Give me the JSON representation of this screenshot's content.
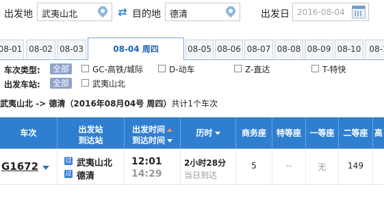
{
  "search": {
    "from_label": "出发地",
    "from_value": "武夷山北",
    "to_label": "目的地",
    "to_value": "德清",
    "date_label": "出发日",
    "date_value": "2016-08-04"
  },
  "date_tabs": [
    "08-01",
    "08-02",
    "08-03",
    "08-04 周四",
    "08-05",
    "08-06",
    "08-07",
    "08-08",
    "08-09",
    "08-10",
    "08-1"
  ],
  "filters": {
    "type_label": "车次类型:",
    "all_label": "全部",
    "types": [
      "GC-高铁/城际",
      "D-动车",
      "Z-直达",
      "T-特快"
    ],
    "station_label": "出发车站:",
    "stations": [
      "武夷山北"
    ]
  },
  "summary": {
    "route": "武夷山北 -> 德清（2016年08月04号 周四）",
    "count": "共计1个车次"
  },
  "table": {
    "headers": {
      "train": "车次",
      "station_1": "出发站",
      "station_2": "到达站",
      "time_1": "出发时间",
      "time_2": "到达时间",
      "duration": "历时",
      "business": "商务座",
      "special": "特等座",
      "first": "一等座",
      "second": "二等座",
      "extra": "高"
    },
    "row": {
      "train_no": "G1672",
      "from_badge": "过",
      "from_station": "武夷山北",
      "to_badge": "过",
      "to_station": "德清",
      "depart": "12:01",
      "arrive": "14:29",
      "duration": "2小时28分",
      "arrival_day": "当日到达",
      "business": "5",
      "special": "--",
      "first": "无",
      "second": "149"
    }
  },
  "colors": {
    "accent": "#2f7fd0",
    "active_tab": "#1b63b4",
    "sort_active": "#ff9a3d"
  }
}
